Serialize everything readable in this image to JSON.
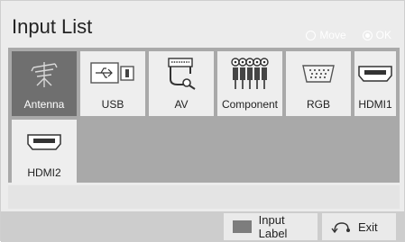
{
  "window": {
    "title": "Input List"
  },
  "hints": {
    "move": "Move",
    "ok": "OK"
  },
  "inputs": [
    {
      "label": "Antenna",
      "icon": "antenna-icon",
      "selected": true
    },
    {
      "label": "USB",
      "icon": "usb-icon",
      "selected": false
    },
    {
      "label": "AV",
      "icon": "av-cable-icon",
      "selected": false
    },
    {
      "label": "Component",
      "icon": "component-cable-icon",
      "selected": false
    },
    {
      "label": "RGB",
      "icon": "rgb-port-icon",
      "selected": false
    },
    {
      "label": "HDMI1",
      "icon": "hdmi-port-icon",
      "selected": false
    },
    {
      "label": "HDMI2",
      "icon": "hdmi-port-icon",
      "selected": false
    }
  ],
  "footer": {
    "input_label": "Input Label",
    "exit": "Exit"
  },
  "colors": {
    "panel": "#a9a9a9",
    "tile": "#eeeeee",
    "selected_tile": "#6f6f6f"
  }
}
